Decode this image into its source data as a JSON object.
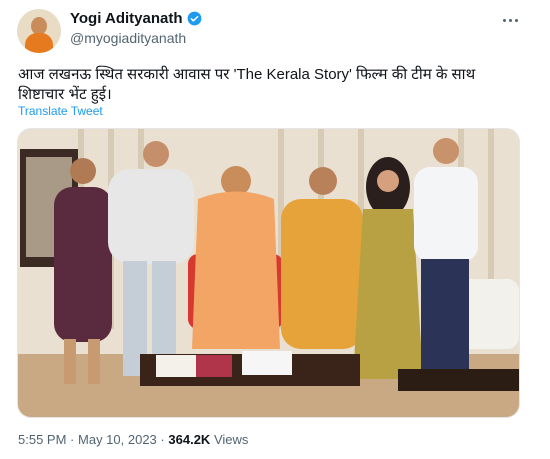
{
  "author": {
    "display_name": "Yogi Adityanath",
    "handle": "@myogiadityanath",
    "verified_icon": "verified-badge-icon",
    "avatar_icon": "avatar"
  },
  "tweet": {
    "text": "आज लखनऊ स्थित सरकारी आवास पर 'The Kerala Story' फिल्म की टीम के साथ शिष्टाचार भेंट हुई।",
    "translate_label": "Translate Tweet",
    "time": "5:55 PM",
    "separator": "·",
    "date": "May 10, 2023",
    "views_count": "364.2K",
    "views_label": "Views"
  },
  "colors": {
    "link": "#1d9bf0",
    "secondary_text": "#536471",
    "verified": "#1d9bf0"
  }
}
